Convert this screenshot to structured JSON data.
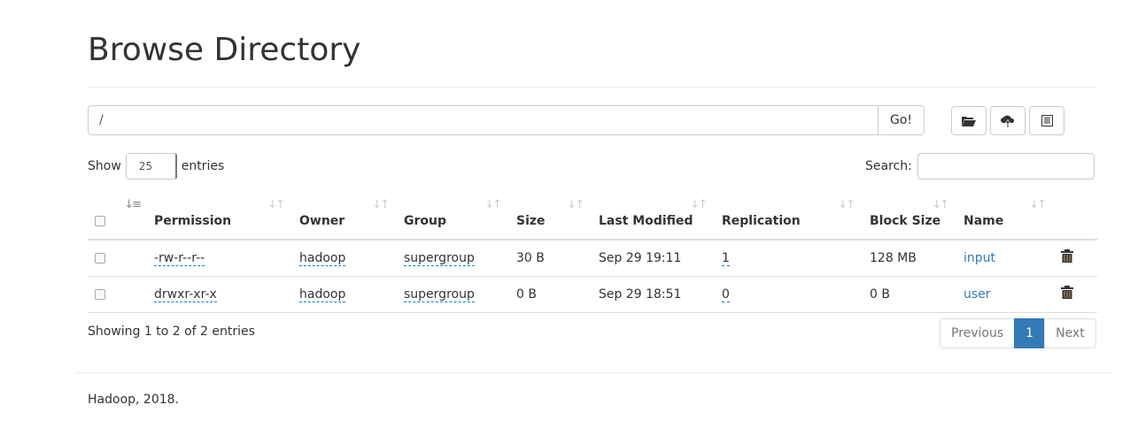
{
  "title": "Browse Directory",
  "path": {
    "value": "/",
    "go": "Go!"
  },
  "toolbar": {
    "icons": [
      "folder-open-icon",
      "cloud-upload-icon",
      "list-alt-icon"
    ]
  },
  "show": {
    "prefix": "Show",
    "value": "25",
    "suffix": "entries"
  },
  "search": {
    "label": "Search:",
    "value": ""
  },
  "columns": [
    "",
    "Permission",
    "Owner",
    "Group",
    "Size",
    "Last Modified",
    "Replication",
    "Block Size",
    "Name",
    ""
  ],
  "rows": [
    {
      "permission": "-rw-r--r--",
      "owner": "hadoop",
      "group": "supergroup",
      "size": "30 B",
      "modified": "Sep 29 19:11",
      "replication": "1",
      "block": "128 MB",
      "name": "input"
    },
    {
      "permission": "drwxr-xr-x",
      "owner": "hadoop",
      "group": "supergroup",
      "size": "0 B",
      "modified": "Sep 29 18:51",
      "replication": "0",
      "block": "0 B",
      "name": "user"
    }
  ],
  "info": "Showing 1 to 2 of 2 entries",
  "pagination": {
    "prev": "Previous",
    "current": "1",
    "next": "Next"
  },
  "footer": "Hadoop, 2018.",
  "colors": {
    "link": "#337ab7",
    "active_page": "#337ab7"
  }
}
